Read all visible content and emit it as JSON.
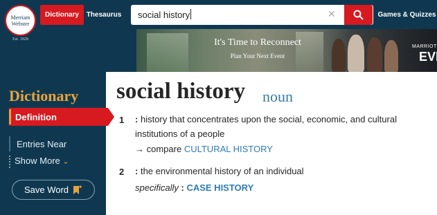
{
  "header": {
    "logo": {
      "line1": "Merriam",
      "line2": "Webster",
      "est": "Est. 1828"
    },
    "tabs": [
      {
        "label": "Dictionary",
        "active": true
      },
      {
        "label": "Thesaurus",
        "active": false
      }
    ],
    "search": {
      "value": "social history",
      "clear_icon": "close-icon",
      "search_icon": "search-icon"
    },
    "games_label": "Games & Quizzes"
  },
  "banner": {
    "headline": "It's Time to Reconnect",
    "subline": "Plan Your Next Event",
    "brand_top": "MARRIOT",
    "brand_bottom": "EVE"
  },
  "sidebar": {
    "title": "Dictionary",
    "items": [
      {
        "label": "Definition",
        "active": true
      },
      {
        "label": "Entries Near",
        "active": false
      },
      {
        "label": "Show More",
        "active": false
      }
    ],
    "show_more_icon": "chevron-down-icon",
    "save_label": "Save Word",
    "save_icon": "bookmark-star-icon"
  },
  "entry": {
    "headword": "social history",
    "part_of_speech": "noun",
    "senses": [
      {
        "number": "1",
        "colon": ":",
        "definition": "history that concentrates upon the social, economic, and cultural institutions of a people",
        "compare_arrow": "→",
        "compare_label": "compare",
        "compare_link": "CULTURAL HISTORY"
      },
      {
        "number": "2",
        "colon": ":",
        "definition": "the environmental history of an individual",
        "specifically_label": "specifically",
        "specifically_colon": ":",
        "specifically_link": "CASE HISTORY"
      }
    ]
  },
  "colors": {
    "navy": "#0f3850",
    "red": "#d71920",
    "gold": "#e8a33d",
    "link": "#2e7cb4"
  }
}
